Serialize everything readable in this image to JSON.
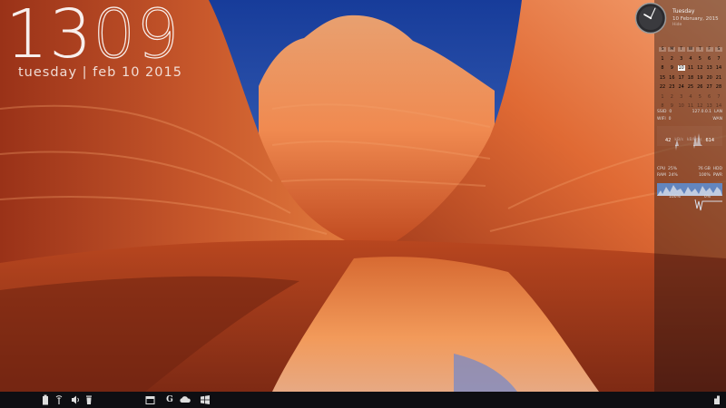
{
  "big_clock": {
    "hours": "13",
    "minutes": "09",
    "date": "tuesday | feb 10 2015"
  },
  "date_gadget": {
    "weekday": "Tuesday",
    "full_date": "10 February, 2015",
    "note": "Hide"
  },
  "calendar": {
    "headers": [
      "S",
      "M",
      "T",
      "W",
      "T",
      "F",
      "S"
    ],
    "weeks": [
      [
        "1",
        "2",
        "3",
        "4",
        "5",
        "6",
        "7"
      ],
      [
        "8",
        "9",
        "10",
        "11",
        "12",
        "13",
        "14"
      ],
      [
        "15",
        "16",
        "17",
        "18",
        "19",
        "20",
        "21"
      ],
      [
        "22",
        "23",
        "24",
        "25",
        "26",
        "27",
        "28"
      ],
      [
        "1",
        "2",
        "3",
        "4",
        "5",
        "6",
        "7"
      ],
      [
        "8",
        "9",
        "10",
        "11",
        "12",
        "13",
        "14"
      ]
    ],
    "today": "10"
  },
  "network": {
    "ssid_label": "SSID",
    "ssid_value": "0",
    "ip_value": "127.0.0.1",
    "lan_label": "LAN",
    "wifi_label": "WIFI",
    "wifi_value": "0",
    "wan_label": "WAN",
    "down_value": "42",
    "kbps_label": "kB/s",
    "up_label": "kB/kms",
    "up_value": "614"
  },
  "system": {
    "cpu_label": "CPU",
    "cpu_value": "25%",
    "hdd_value": "76 GB",
    "hdd_label": "HDD",
    "ram_label": "RAM",
    "ram_value": "24%",
    "pwr_value": "100%",
    "pwr_label": "PWR",
    "bottom_left": "100%",
    "bottom_right": "0%"
  },
  "taskbar": {
    "icons": [
      "battery-icon",
      "wifi-signal-icon",
      "volume-icon",
      "recycle-bin-icon",
      "folder-icon",
      "google-icon",
      "cloud-icon",
      "windows-logo-icon",
      "notification-icon"
    ]
  },
  "colors": {
    "sky": "#2b4fa8",
    "rock_light": "#f08a4a",
    "rock_dark": "#7a2614",
    "taskbar": "#0e0e12"
  }
}
